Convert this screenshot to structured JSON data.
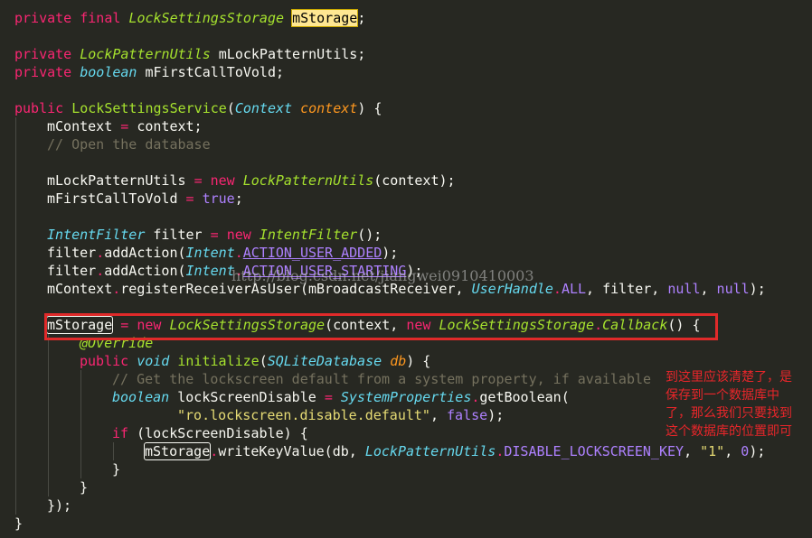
{
  "code": {
    "l1": {
      "kw": "private final",
      "type": "LockSettingsStorage",
      "var": "mStorage",
      "end": ";"
    },
    "l3": {
      "kw": "private",
      "type": "LockPatternUtils",
      "rest": " mLockPatternUtils;"
    },
    "l4": {
      "kw": "private",
      "type": "boolean",
      "rest": " mFirstCallToVold;"
    },
    "l6": {
      "kw": "public",
      "fn": "LockSettingsService",
      "open": "(",
      "ptype": "Context",
      "pname": "context",
      "close": ") {"
    },
    "l7": {
      "text": "mContext ",
      "op": "=",
      "rest": " context;"
    },
    "l8": {
      "comment": "// Open the database"
    },
    "l10": {
      "text": "mLockPatternUtils ",
      "op": "=",
      "kw": "new",
      "type": "LockPatternUtils",
      "rest": "(context);"
    },
    "l11": {
      "text": "mFirstCallToVold ",
      "op": "=",
      "val": "true",
      "end": ";"
    },
    "l13": {
      "type": "IntentFilter",
      "text": " filter ",
      "op": "=",
      "kw": "new",
      "type2": "IntentFilter",
      "rest": "();"
    },
    "l14": {
      "text": "filter",
      "dot": ".",
      "m": "addAction(",
      "type": "Intent",
      "dot2": ".",
      "c": "ACTION_USER_ADDED",
      "end": ");"
    },
    "l15": {
      "text": "filter",
      "dot": ".",
      "m": "addAction(",
      "type": "Intent",
      "dot2": ".",
      "c": "ACTION_USER_STARTING",
      "end": ");"
    },
    "l16": {
      "text": "mContext",
      "dot": ".",
      "m": "registerReceiverAsUser(mBroadcastReceiver, ",
      "type": "UserHandle",
      "dot2": ".",
      "c": "ALL",
      "mid": ", filter, ",
      "n1": "null",
      "sep": ", ",
      "n2": "null",
      "end": ");"
    },
    "l18": {
      "var": "mStorage",
      "op": " = ",
      "kw": "new",
      "type": "LockSettingsStorage",
      "mid": "(context, ",
      "kw2": "new",
      "type2": "LockSettingsStorage",
      "dot": ".",
      "type3": "Callback",
      "end": "() {"
    },
    "l19": {
      "ann": "@Override"
    },
    "l20": {
      "kw": "public",
      "ty": "void",
      "fn": "initialize",
      "open": "(",
      "ptype": "SQLiteDatabase",
      "pname": "db",
      "close": ") {"
    },
    "l21": {
      "comment": "// Get the lockscreen default from a system property, if available"
    },
    "l22": {
      "ty": "boolean",
      "text": " lockScreenDisable ",
      "op": "=",
      "type": "SystemProperties",
      "dot": ".",
      "m": "getBoolean("
    },
    "l23": {
      "str": "\"ro.lockscreen.disable.default\"",
      "mid": ", ",
      "val": "false",
      "end": ");"
    },
    "l24": {
      "kw": "if",
      "rest": " (lockScreenDisable) {"
    },
    "l25": {
      "var": "mStorage",
      "dot": ".",
      "m": "writeKeyValue(db, ",
      "type": "LockPatternUtils",
      "dot2": ".",
      "c": "DISABLE_LOCKSCREEN_KEY",
      "mid": ", ",
      "str": "\"1\"",
      "sep": ", ",
      "num": "0",
      "end": ");"
    },
    "l26": {
      "text": "}"
    },
    "l27": {
      "text": "}"
    },
    "l28": {
      "text": "});"
    },
    "l29": {
      "text": "}"
    }
  },
  "watermark": "http://blog.csdn.net/jiangwei0910410003",
  "annotation_note": [
    "到这里应该清楚了，是",
    "保存到一个数据库中",
    "了，那么我们只要找到",
    "这个数据库的位置即可"
  ],
  "colors": {
    "background": "#272822",
    "highlight_box": "#e02a2a",
    "note_text": "#e8262a",
    "search_highlight": "#ffe792"
  }
}
